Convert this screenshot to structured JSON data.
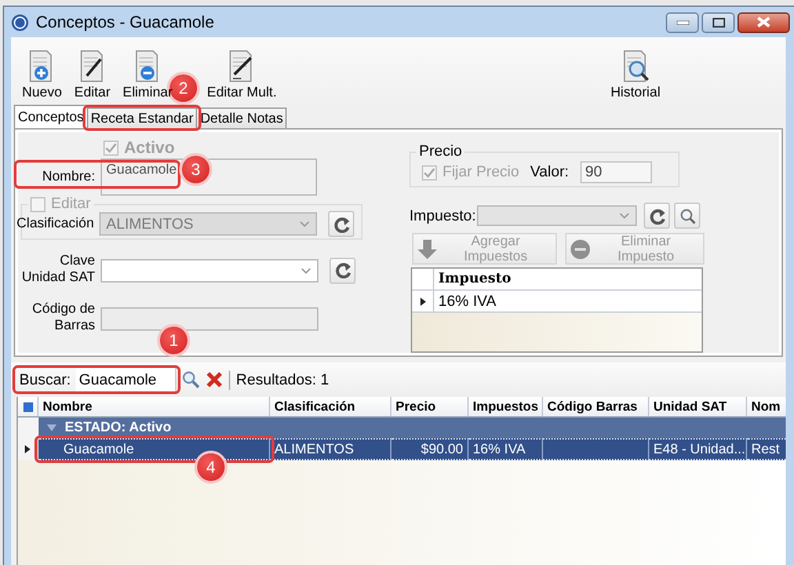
{
  "window": {
    "title": "Conceptos - Guacamole"
  },
  "toolbar": [
    {
      "kind": "new",
      "label": "Nuevo"
    },
    {
      "kind": "edit",
      "label": "Editar"
    },
    {
      "kind": "delete",
      "label": "Eliminar"
    },
    {
      "kind": "edit-multi",
      "label": "Editar Mult."
    },
    {
      "kind": "history",
      "label": "Historial"
    }
  ],
  "tabs": [
    {
      "label": "Conceptos",
      "selected": true
    },
    {
      "label": "Receta Estandar",
      "selected": false
    },
    {
      "label": "Detalle Notas",
      "selected": false
    }
  ],
  "form": {
    "activo": {
      "label": "Activo",
      "checked": true,
      "disabled": true
    },
    "nombre": {
      "label": "Nombre:",
      "value": "Guacamole"
    },
    "editar": {
      "label": "Editar",
      "checked": false,
      "disabled": true
    },
    "clasificacion": {
      "label": "Clasificación",
      "value": "ALIMENTOS",
      "disabled": true
    },
    "clave": {
      "label": "Clave Unidad SAT",
      "disabled": false
    },
    "codigo": {
      "label": "Código de Barras"
    },
    "precio": {
      "title": "Precio",
      "fijar": {
        "label": "Fijar Precio",
        "checked": true,
        "disabled": true
      },
      "valor_label": "Valor:",
      "valor": "90"
    },
    "impuesto": {
      "label": "Impuesto:"
    },
    "tax_buttons": [
      {
        "kind": "add",
        "label": "Agregar Impuestos",
        "disabled": true
      },
      {
        "kind": "remove",
        "label": "Eliminar Impuesto",
        "disabled": true
      }
    ],
    "tax_grid": {
      "columns": [
        "Impuesto"
      ],
      "rows": [
        {
          "cells": [
            "16% IVA"
          ]
        }
      ]
    }
  },
  "search": {
    "label": "Buscar:",
    "value": "Guacamole",
    "results_label": "Resultados:",
    "results": "1"
  },
  "grid": {
    "columns": [
      "Nombre",
      "Clasificación",
      "Precio",
      "Impuestos",
      "Código Barras",
      "Unidad SAT",
      "Nom"
    ],
    "groups": [
      {
        "label": "ESTADO: Activo",
        "expanded": true,
        "rows": [
          {
            "cells": [
              "Guacamole",
              "ALIMENTOS",
              "$90.00",
              "16% IVA",
              "",
              "E48 - Unidad...",
              "Rest"
            ],
            "selected": true
          }
        ]
      }
    ]
  },
  "annotations": [
    {
      "kind": "frame"
    },
    {
      "kind": "frame"
    },
    {
      "kind": "frame"
    },
    {
      "kind": "frame"
    },
    {
      "kind": "badge",
      "label": "2"
    },
    {
      "kind": "badge",
      "label": "3"
    },
    {
      "kind": "badge",
      "label": "1"
    },
    {
      "kind": "badge",
      "label": "4"
    }
  ]
}
